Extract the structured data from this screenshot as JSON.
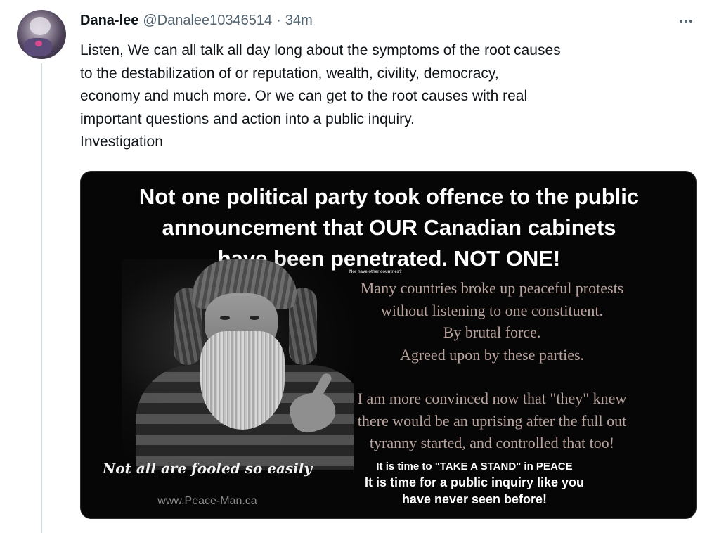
{
  "tweet": {
    "author_name": "Dana-lee",
    "author_handle": "@Danalee10346514",
    "separator": "·",
    "time": "34m",
    "text_lines": [
      "Listen, We can all talk all day long about the symptoms of the root causes",
      "to the destabilization of or reputation, wealth, civility, democracy,",
      "economy and much more. Or we can get to the root causes with real",
      "important questions and action into a public inquiry.",
      "Investigation"
    ]
  },
  "image": {
    "headline_lines": [
      "Not one political party took offence to the public",
      "announcement that OUR Canadian cabinets",
      "have been penetrated. NOT ONE!"
    ],
    "tiny_note": "Nor have other countries?",
    "body_lines_1": [
      "Many countries broke up peaceful protests",
      "without listening to one constituent.",
      "By brutal force.",
      "Agreed upon by these parties."
    ],
    "body_lines_2": [
      "I am more convinced now that \"they\" knew",
      "there would be an uprising after the full out",
      "tyranny started, and controlled that too!"
    ],
    "cta_line_1": "It is time to \"TAKE A STAND\" in PEACE",
    "cta_line_2": "It is time for a public inquiry like you",
    "cta_line_3": "have never seen before!",
    "quote": "Not all are fooled so easily",
    "website": "www.Peace-Man.ca"
  },
  "colors": {
    "text_primary": "#0f1419",
    "text_secondary": "#536471",
    "thread_line": "#cfd9de",
    "image_bg": "#060606",
    "serif_text": "#b9a39d"
  },
  "icons": {
    "more": "more-horizontal-icon"
  }
}
